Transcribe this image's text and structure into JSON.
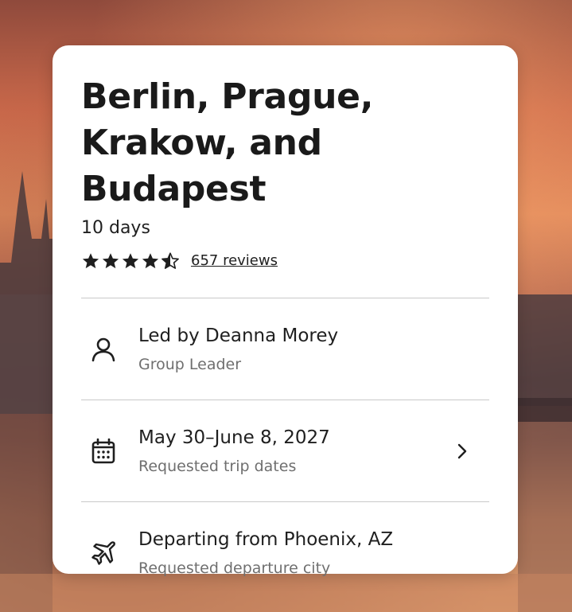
{
  "trip": {
    "title": "Berlin, Prague, Krakow, and Budapest",
    "duration": "10 days",
    "rating": 4.5,
    "rating_max": 5,
    "reviews_label": "657 reviews"
  },
  "details": [
    {
      "icon": "person-icon",
      "primary": "Led by Deanna Morey",
      "secondary": "Group Leader"
    },
    {
      "icon": "calendar-icon",
      "primary": "May 30–June 8, 2027",
      "secondary": "Requested trip dates",
      "has_chevron": true
    },
    {
      "icon": "airplane-icon",
      "primary": "Departing from Phoenix, AZ",
      "secondary": "Requested departure city"
    }
  ],
  "colors": {
    "card_background": "#ffffff",
    "text_primary": "#1f1f1f",
    "text_secondary": "#6f6f6f",
    "divider": "#c9c9c9"
  }
}
